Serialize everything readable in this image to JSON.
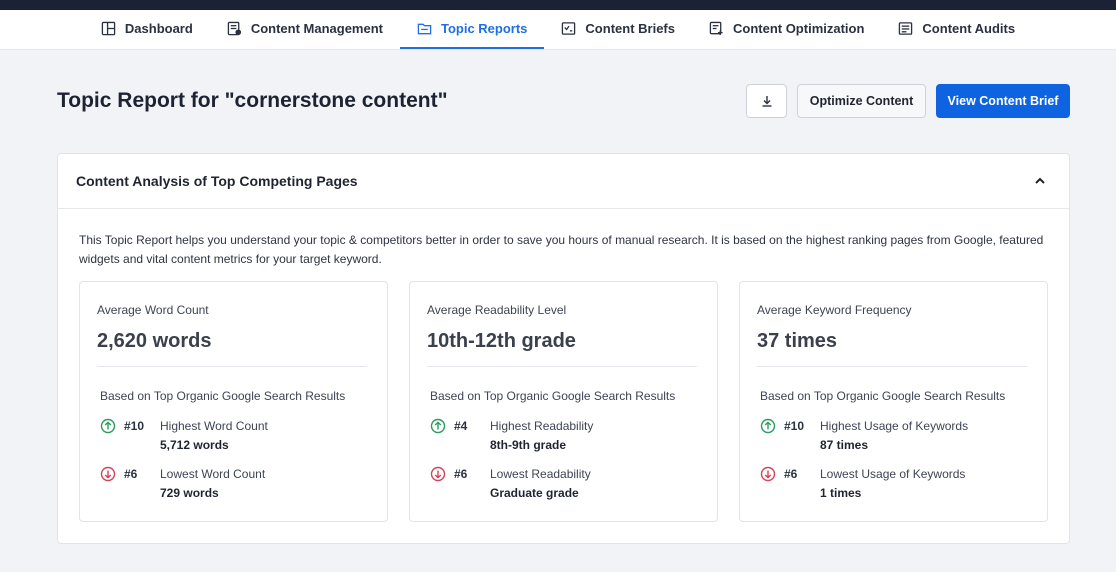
{
  "nav": {
    "items": [
      {
        "label": "Dashboard",
        "icon": "dashboard-icon"
      },
      {
        "label": "Content Management",
        "icon": "content-management-icon"
      },
      {
        "label": "Topic Reports",
        "icon": "topic-reports-icon",
        "active": true
      },
      {
        "label": "Content Briefs",
        "icon": "content-briefs-icon"
      },
      {
        "label": "Content Optimization",
        "icon": "content-optimization-icon"
      },
      {
        "label": "Content Audits",
        "icon": "content-audits-icon"
      }
    ]
  },
  "header": {
    "title": "Topic Report for \"cornerstone content\"",
    "download_icon": "download-icon",
    "optimize_label": "Optimize Content",
    "view_brief_label": "View Content Brief"
  },
  "panel": {
    "title": "Content Analysis of Top Competing Pages",
    "intro": "This Topic Report helps you understand your topic & competitors better in order to save you hours of manual research. It is based on the highest ranking pages from Google, featured widgets and vital content metrics for your target keyword.",
    "cards": [
      {
        "label": "Average Word Count",
        "value": "2,620 words",
        "source": "Based on Top Organic Google Search Results",
        "high": {
          "rank": "#10",
          "label": "Highest Word Count",
          "value": "5,712 words"
        },
        "low": {
          "rank": "#6",
          "label": "Lowest Word Count",
          "value": "729 words"
        }
      },
      {
        "label": "Average Readability Level",
        "value": "10th-12th grade",
        "source": "Based on Top Organic Google Search Results",
        "high": {
          "rank": "#4",
          "label": "Highest Readability",
          "value": "8th-9th grade"
        },
        "low": {
          "rank": "#6",
          "label": "Lowest Readability",
          "value": "Graduate grade"
        }
      },
      {
        "label": "Average Keyword Frequency",
        "value": "37 times",
        "source": "Based on Top Organic Google Search Results",
        "high": {
          "rank": "#10",
          "label": "Highest Usage of Keywords",
          "value": "87 times"
        },
        "low": {
          "rank": "#6",
          "label": "Lowest Usage of Keywords",
          "value": "1 times"
        }
      }
    ]
  },
  "colors": {
    "accent": "#1f6fe5",
    "primary_button": "#0d63e0",
    "up_green": "#2c9c5c",
    "down_red": "#d1435b",
    "topbar": "#1b2236"
  }
}
